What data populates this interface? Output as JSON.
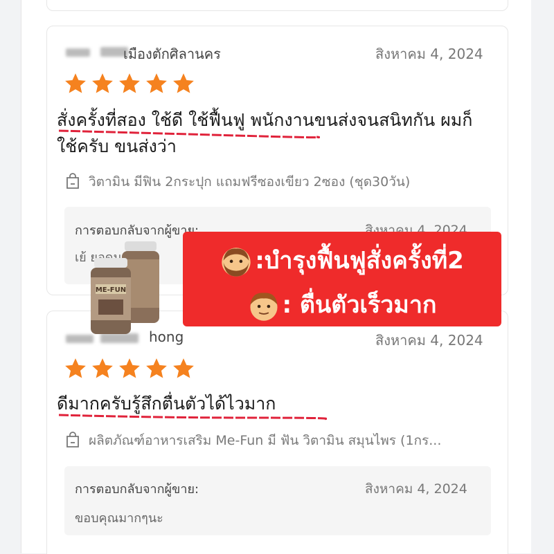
{
  "reviews": [
    {
      "username": "เมืองตักศิลานคร",
      "date": "สิงหาคม 4, 2024",
      "rating": 5,
      "text": "สั่งครั้งที่สอง ใช้ดี ใช้ฟื้นฟู พนักงานขนส่งจนสนิทกัน ผมก็ใช้ครับ ขนส่งว่า",
      "product": "วิตามิน มีฟิน 2กระปุก แถมฟรีซองเขียว 2ซอง (ชุด30วัน)",
      "reply_label": "การตอบกลับจากผู้ขาย:",
      "reply_date": "สิงหาคม 4, 2024",
      "reply_text": "เย้ ยอดมากกาจุ"
    },
    {
      "username": "hong",
      "date": "สิงหาคม 4, 2024",
      "rating": 5,
      "text": "ดีมากครับรู้สึกตื่นตัวได้ไวมาก",
      "product": "ผลิตภัณฑ์อาหารเสริม  Me-Fun มี ฟัน วิตามิน สมุนไพร  (1กร...",
      "reply_label": "การตอบกลับจากผู้ขาย:",
      "reply_date": "สิงหาคม 4, 2024",
      "reply_text": "ขอบคุณมากๆนะ"
    }
  ],
  "promo": {
    "line1": ":บำรุงฟื้นฟูสั่งครั้งที่2",
    "line2": ": ตื่นตัวเร็วมาก",
    "icon1": "bearded-man-face-icon",
    "icon2": "man-face-icon",
    "background": "#ef2b2b"
  },
  "colors": {
    "star": "#f5821f",
    "underline": "#e0223a"
  },
  "product_image": {
    "label": "ME-FUN"
  }
}
